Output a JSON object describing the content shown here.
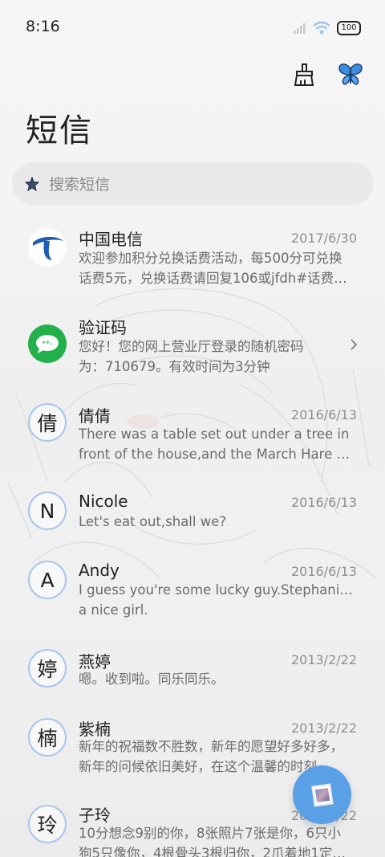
{
  "status": {
    "time": "8:16",
    "battery": "100"
  },
  "header": {
    "title": "短信"
  },
  "search": {
    "placeholder": "搜索短信"
  },
  "threads": [
    {
      "avatar_type": "logo-china-telecom",
      "avatar_char": "",
      "name": "中国电信",
      "date": "2017/6/30",
      "lines": [
        "欢迎参加积分兑换话费活动，每500分可兑换",
        "话费5元，兑换话费请回复106或jfdh#话费…"
      ]
    },
    {
      "avatar_type": "logo-sms-green",
      "avatar_char": "",
      "name": "验证码",
      "date": "",
      "lines": [
        "您好！您的网上营业厅登录的随机密码",
        "为：710679。有效时间为3分钟"
      ]
    },
    {
      "avatar_type": "letter",
      "avatar_char": "倩",
      "name": "倩倩",
      "date": "2016/6/13",
      "lines": [
        "There was a table set out under a tree in",
        "front of the house,and the March Hare an…"
      ]
    },
    {
      "avatar_type": "letter",
      "avatar_char": "N",
      "name": "Nicole",
      "date": "2016/6/13",
      "lines": [
        "Let's eat out,shall we?"
      ]
    },
    {
      "avatar_type": "letter",
      "avatar_char": "A",
      "name": "Andy",
      "date": "2016/6/13",
      "lines": [
        "I guess you're some lucky guy.Stephanie is",
        "a nice girl."
      ]
    },
    {
      "avatar_type": "letter",
      "avatar_char": "婷",
      "name": "燕婷",
      "date": "2013/2/22",
      "lines": [
        "嗯。收到啦。同乐同乐。"
      ]
    },
    {
      "avatar_type": "letter",
      "avatar_char": "楠",
      "name": "紫楠",
      "date": "2013/2/22",
      "lines": [
        "新年的祝福数不胜数，新年的愿望好多好多，",
        "新年的问候依旧美好，在这个温馨的时刻…"
      ]
    },
    {
      "avatar_type": "letter",
      "avatar_char": "玲",
      "name": "子玲",
      "date": "2013/2/22",
      "lines": [
        "10分想念9别的你，8张照片7张是你，6只小",
        "狗5只像你，4根骨头3根归你，2爪着地1定…"
      ]
    }
  ],
  "colors": {
    "accent": "#5aa0e6",
    "avatar_ring": "#a9c5ec",
    "telecom_blue": "#1e5fb0",
    "sms_green": "#22b04b"
  },
  "icons": [
    "broom-icon",
    "butterfly-icon",
    "search-icon",
    "chevron-right-icon",
    "compose-icon"
  ]
}
